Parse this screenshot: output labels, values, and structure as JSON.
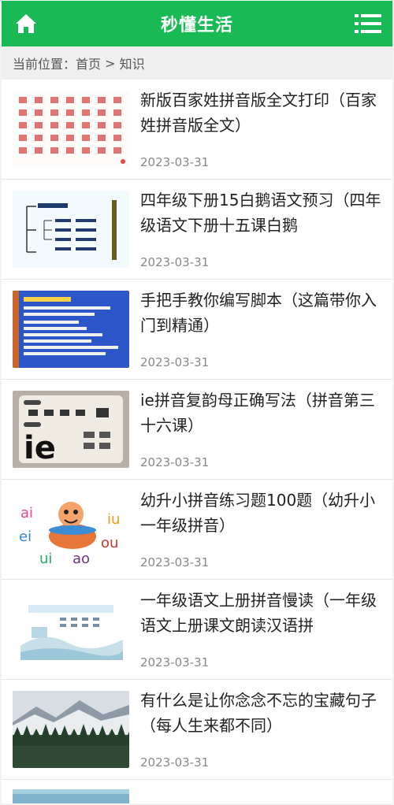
{
  "header": {
    "title": "秒懂生活",
    "colors": {
      "brand": "#19b955"
    },
    "home_icon": "home-icon",
    "menu_icon": "menu-icon"
  },
  "breadcrumb": {
    "prefix": "当前位置：",
    "home": "首页",
    "separator": " > ",
    "current": "知识"
  },
  "articles": [
    {
      "title": "新版百家姓拼音版全文打印（百家姓拼音版全文）",
      "date": "2023-03-31",
      "thumb": "chinese-surname-chart"
    },
    {
      "title": "四年级下册15白鹅语文预习（四年级语文下册十五课白鹅",
      "date": "2023-03-31",
      "thumb": "lesson-mindmap"
    },
    {
      "title": "手把手教你编写脚本（这篇带你入门到精通）",
      "date": "2023-03-31",
      "thumb": "script-slide"
    },
    {
      "title": "ie拼音复韵母正确写法（拼音第三十六课）",
      "date": "2023-03-31",
      "thumb": "ie-pinyin-card"
    },
    {
      "title": "幼升小拼音练习题100题（幼升小一年级拼音）",
      "date": "2023-03-31",
      "thumb": "pinyin-cartoon"
    },
    {
      "title": "一年级语文上册拼音慢读（一年级语文上册课文朗读汉语拼",
      "date": "2023-03-31",
      "thumb": "pinyin-landscape"
    },
    {
      "title": "有什么是让你念念不忘的宝藏句子（每人生来都不同）",
      "date": "2023-03-31",
      "thumb": "mountain-forest"
    }
  ],
  "thumb_text": {
    "ie": "ie",
    "cartoon": [
      "ai",
      "iu",
      "ei",
      "ou",
      "ui",
      "ao"
    ]
  }
}
